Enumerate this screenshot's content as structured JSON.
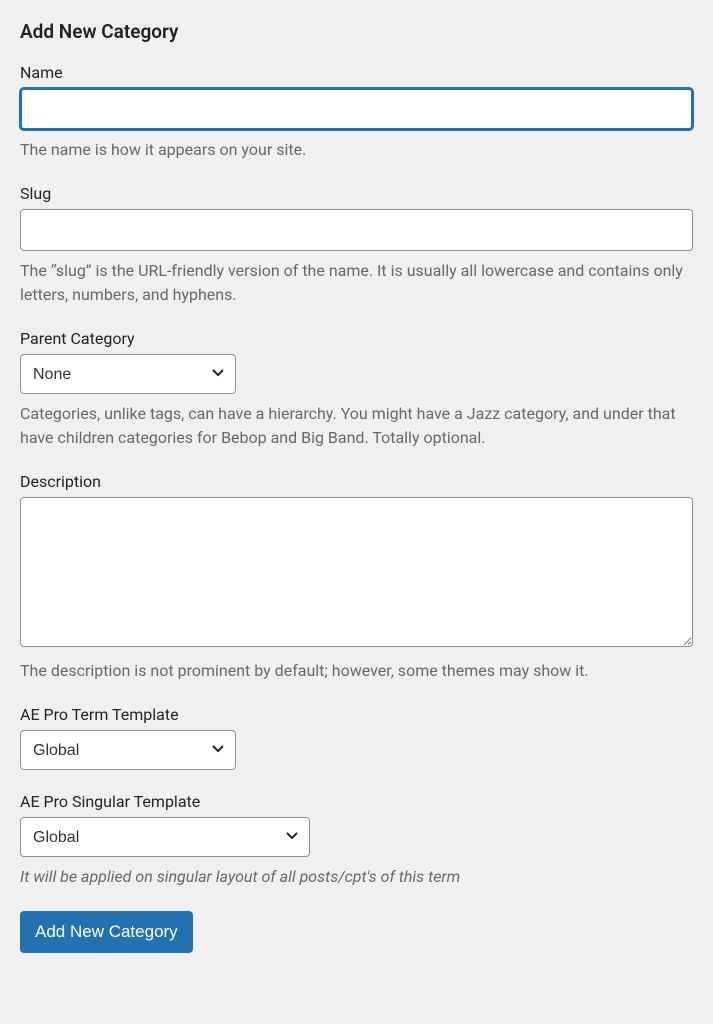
{
  "heading": "Add New Category",
  "fields": {
    "name": {
      "label": "Name",
      "value": "",
      "help": "The name is how it appears on your site."
    },
    "slug": {
      "label": "Slug",
      "value": "",
      "help": "The “slug” is the URL-friendly version of the name. It is usually all lowercase and contains only letters, numbers, and hyphens."
    },
    "parent": {
      "label": "Parent Category",
      "selected": "None",
      "help": "Categories, unlike tags, can have a hierarchy. You might have a Jazz category, and under that have children categories for Bebop and Big Band. Totally optional."
    },
    "description": {
      "label": "Description",
      "value": "",
      "help": "The description is not prominent by default; however, some themes may show it."
    },
    "term_template": {
      "label": "AE Pro Term Template",
      "selected": "Global"
    },
    "singular_template": {
      "label": "AE Pro Singular Template",
      "selected": "Global",
      "help": "It will be applied on singular layout of all posts/cpt's of this term"
    }
  },
  "submit_label": "Add New Category"
}
